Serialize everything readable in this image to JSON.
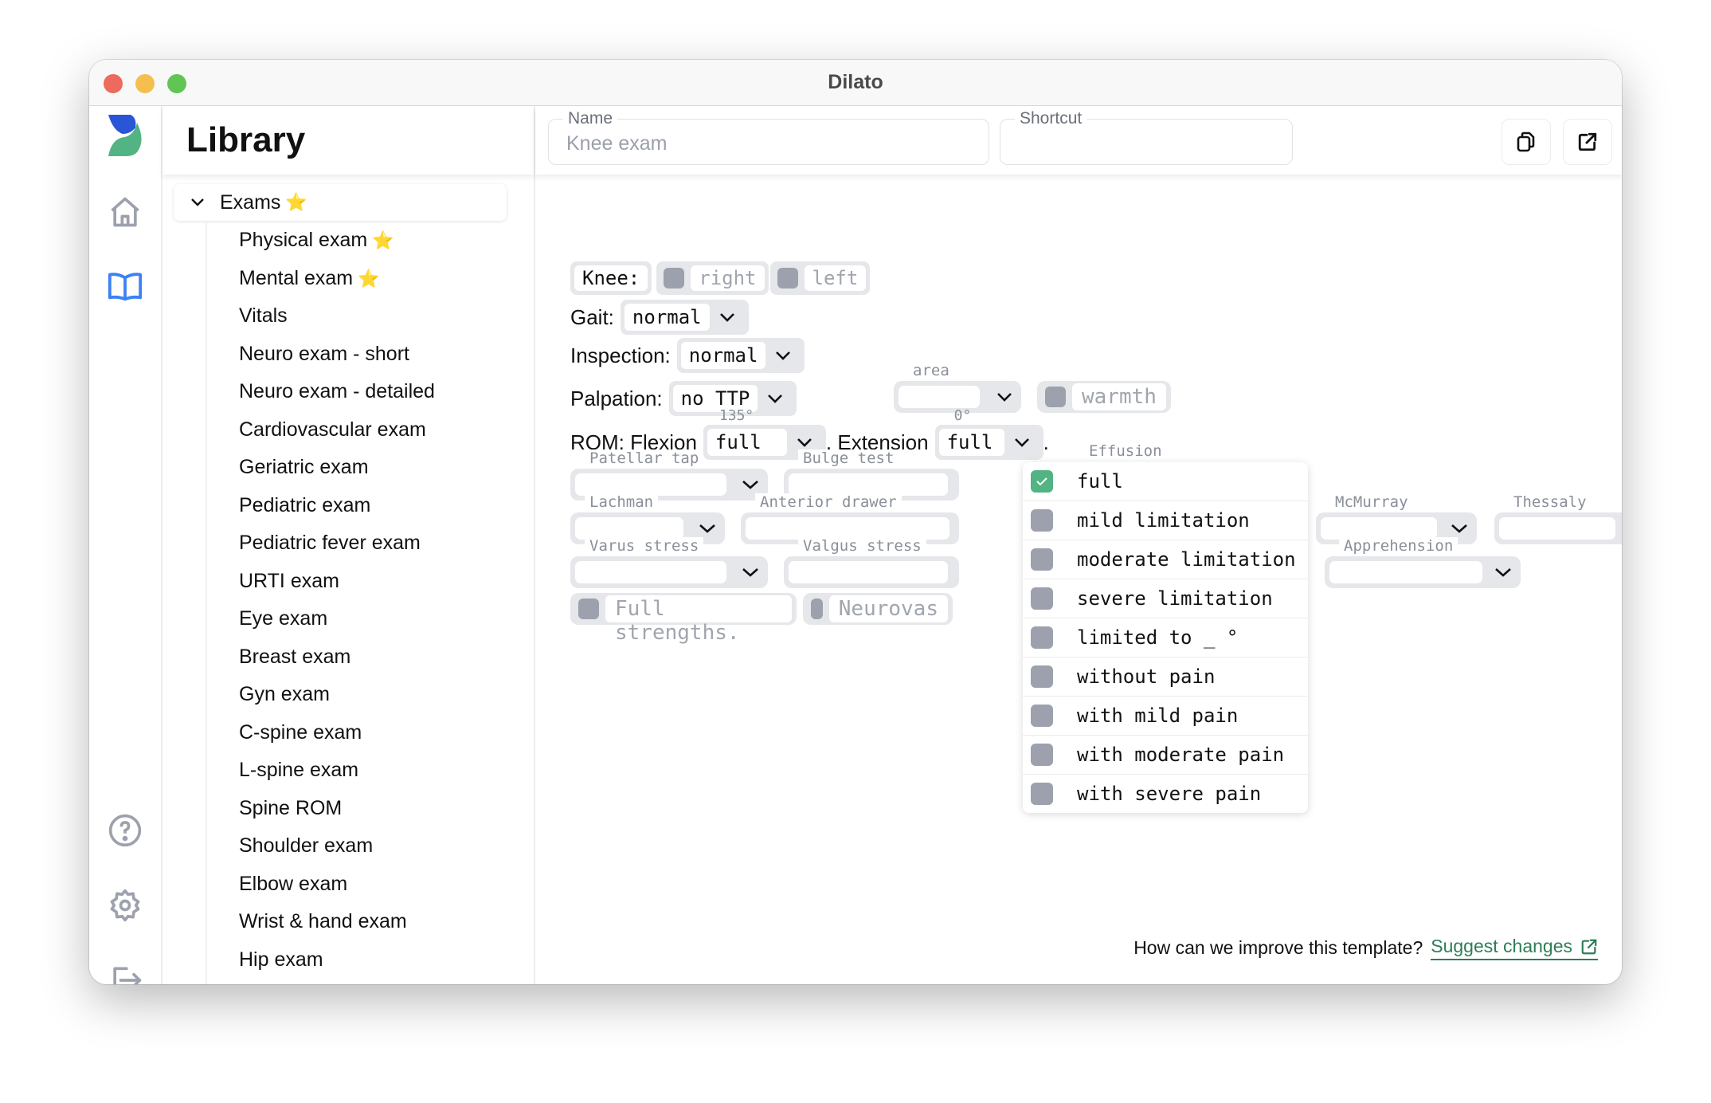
{
  "window": {
    "title": "Dilato"
  },
  "rail": {
    "items": [
      {
        "icon": "logo-icon"
      },
      {
        "icon": "home-icon"
      },
      {
        "icon": "library-book-icon",
        "active": true
      },
      {
        "icon": "help-icon"
      },
      {
        "icon": "settings-gear-icon"
      },
      {
        "icon": "logout-icon"
      }
    ]
  },
  "library": {
    "title": "Library",
    "group": {
      "label": "Exams",
      "starred": "⭐"
    },
    "items": [
      {
        "label": "Physical exam",
        "star": "⭐"
      },
      {
        "label": "Mental exam",
        "star": "⭐"
      },
      {
        "label": "Vitals",
        "star": ""
      },
      {
        "label": "Neuro exam - short",
        "star": ""
      },
      {
        "label": "Neuro exam - detailed",
        "star": ""
      },
      {
        "label": "Cardiovascular exam",
        "star": ""
      },
      {
        "label": "Geriatric exam",
        "star": ""
      },
      {
        "label": "Pediatric exam",
        "star": ""
      },
      {
        "label": "Pediatric fever exam",
        "star": ""
      },
      {
        "label": "URTI exam",
        "star": ""
      },
      {
        "label": "Eye exam",
        "star": ""
      },
      {
        "label": "Breast exam",
        "star": ""
      },
      {
        "label": "Gyn exam",
        "star": ""
      },
      {
        "label": "C-spine exam",
        "star": ""
      },
      {
        "label": "L-spine exam",
        "star": ""
      },
      {
        "label": "Spine ROM",
        "star": ""
      },
      {
        "label": "Shoulder exam",
        "star": ""
      },
      {
        "label": "Elbow exam",
        "star": ""
      },
      {
        "label": "Wrist & hand exam",
        "star": ""
      },
      {
        "label": "Hip exam",
        "star": ""
      }
    ]
  },
  "header": {
    "name_label": "Name",
    "name_value": "Knee exam",
    "shortcut_label": "Shortcut",
    "shortcut_value": "",
    "copy_button": "copy-icon",
    "open_button": "external-link-icon"
  },
  "template": {
    "knee_label": "Knee:",
    "knee_right": "right",
    "knee_left": "left",
    "gait_label": "Gait:",
    "gait_value": "normal",
    "inspection_label": "Inspection:",
    "inspection_value": "normal",
    "palpation_label": "Palpation:",
    "palpation_value": "no TTP",
    "area_label": "area",
    "area_value": "",
    "warmth": "warmth",
    "rom_label": "ROM: Flexion",
    "flexion_hint": "135°",
    "flexion_value": "full",
    "extension_label": ". Extension",
    "extension_hint": "0°",
    "extension_value": "full",
    "period": ".",
    "patellar_tap": "Patellar tap",
    "bulge_test": "Bulge test",
    "effusion": "Effusion",
    "lachman": "Lachman",
    "anterior_drawer": "Anterior drawer",
    "mcmurray": "McMurray",
    "thessaly": "Thessaly",
    "varus_stress": "Varus stress",
    "valgus_stress": "Valgus stress",
    "apprehension": "Apprehension",
    "full_strengths": "Full strengths.",
    "neurovas": "Neurovas"
  },
  "dropdown": {
    "options": [
      {
        "label": "full",
        "checked": true
      },
      {
        "label": "mild limitation",
        "checked": false
      },
      {
        "label": "moderate limitation",
        "checked": false
      },
      {
        "label": "severe limitation",
        "checked": false
      },
      {
        "label": "limited to _ °",
        "checked": false
      },
      {
        "label": "without pain",
        "checked": false
      },
      {
        "label": "with mild pain",
        "checked": false
      },
      {
        "label": "with moderate pain",
        "checked": false
      },
      {
        "label": "with severe pain",
        "checked": false
      }
    ]
  },
  "footer": {
    "question": "How can we improve this template?",
    "link": "Suggest changes"
  },
  "colors": {
    "accent_green": "#52b383",
    "link_green": "#2e7d57",
    "active_blue": "#3b82f6",
    "checkbox_gray": "#9ca1ad"
  }
}
